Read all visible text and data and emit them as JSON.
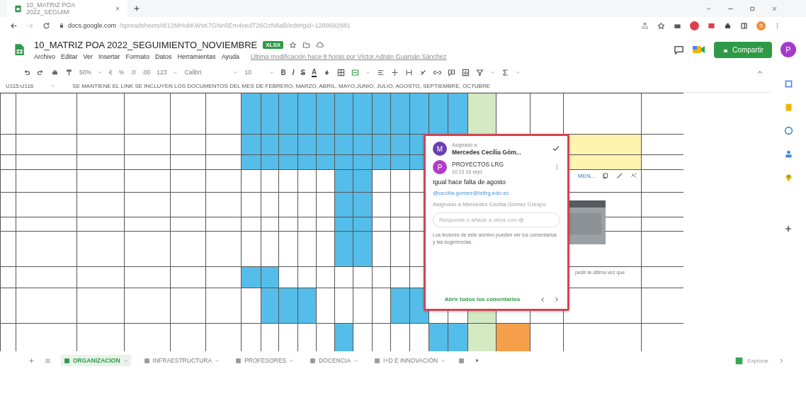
{
  "browser": {
    "tab_title": "10_MATRIZ POA 2022_SEGUIM",
    "url_host": "docs.google.com",
    "url_path": "/spreadsheets/d/12MHokKWsK7GNn5Em4vedT26GzN8aB/edit#gid=1289692881",
    "profile_letter": "S"
  },
  "document": {
    "title": "10_MATRIZ POA 2022_SEGUIMIENTO_NOVIEMBRE",
    "badge": "XLSX",
    "menu": [
      "Archivo",
      "Editar",
      "Ver",
      "Insertar",
      "Formato",
      "Datos",
      "Herramientas",
      "Ayuda"
    ],
    "last_edit": "Última modificación hace 8 horas por Víctor Adrián Guamán Sánchez",
    "share_label": "Compartir",
    "avatar_letter": "P"
  },
  "toolbar": {
    "zoom": "50%",
    "currency": "€",
    "percent": "%",
    "decimals_less": ".0",
    "decimals_more": ".00",
    "number_format": "123",
    "font": "Calibri",
    "font_size": "10",
    "bold": "B",
    "italic": "I",
    "strike": "S",
    "text_color": "A"
  },
  "formula_bar": {
    "cell_ref": "U115:U116",
    "content": "SE MANTIENE EL LINK SE INCLUYEN LOS DOCUMENTOS DEL MES DE FEBRERO, MARZO, ABRIL, MAYO,JUNIO, JULIO, AGOSTO, SEPTIEMBRE, OCTUBRE"
  },
  "grid": {
    "link_chip": "MEN...",
    "cell_text": "pedir la última vez que"
  },
  "comment": {
    "assigned_label": "Asignado a",
    "assignee": "Mercedes Cecilia Góm...",
    "author": "PROYECTOS LRG",
    "author_letter": "P",
    "assignee_letter": "M",
    "time": "10:13 16 sept",
    "text": "Igual hace falta de agosto",
    "mention": "@cecilia.gomez@istlrg.edu.ec",
    "assignment_note": "Asignado a Mercedes Cecilia Gómez Crespo",
    "reply_placeholder": "Responde o añade a otros con @",
    "notice": "Los lectores de este archivo pueden ver los comentarios y las sugerencias.",
    "open_all": "Abrir todos los comentarios"
  },
  "sheet_tabs": [
    {
      "label": "ORGANIZACION",
      "selected": true
    },
    {
      "label": "INFRAESTRUCTURA",
      "selected": false
    },
    {
      "label": "PROFESORES",
      "selected": false
    },
    {
      "label": "DOCENCIA",
      "selected": false
    },
    {
      "label": "I+D E INNOVACIÓN",
      "selected": false
    }
  ],
  "explore_label": "Explorar"
}
